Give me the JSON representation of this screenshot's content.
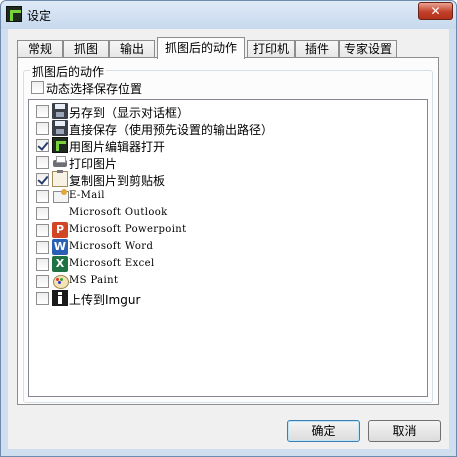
{
  "window": {
    "title": "设定",
    "close_label": "✕"
  },
  "tabs": [
    {
      "label": "常规"
    },
    {
      "label": "抓图"
    },
    {
      "label": "输出"
    },
    {
      "label": "抓图后的动作"
    },
    {
      "label": "打印机"
    },
    {
      "label": "插件"
    },
    {
      "label": "专家设置"
    }
  ],
  "active_tab": "抓图后的动作",
  "group": {
    "legend": "抓图后的动作",
    "dynamic_location_label": "动态选择保存位置",
    "dynamic_location_checked": false
  },
  "destinations": [
    {
      "label": "另存到（显示对话框）",
      "icon": "save-icon",
      "checked": false
    },
    {
      "label": "直接保存（使用预先设置的输出路径）",
      "icon": "save-icon",
      "checked": false
    },
    {
      "label": "用图片编辑器打开",
      "icon": "image-editor-icon",
      "checked": true
    },
    {
      "label": "打印图片",
      "icon": "printer-icon",
      "checked": false
    },
    {
      "label": "复制图片到剪贴板",
      "icon": "clipboard-icon",
      "checked": true
    },
    {
      "label": "E-Mail",
      "icon": "email-icon",
      "checked": false
    },
    {
      "label": "Microsoft Outlook",
      "icon": "",
      "checked": false
    },
    {
      "label": "Microsoft Powerpoint",
      "icon": "powerpoint-icon",
      "checked": false
    },
    {
      "label": "Microsoft Word",
      "icon": "word-icon",
      "checked": false
    },
    {
      "label": "Microsoft Excel",
      "icon": "excel-icon",
      "checked": false
    },
    {
      "label": "MS Paint",
      "icon": "paint-icon",
      "checked": false
    },
    {
      "label": "上传到Imgur",
      "icon": "imgur-icon",
      "checked": false
    }
  ],
  "icon_glyphs": {
    "powerpoint": "P",
    "word": "W",
    "excel": "X"
  },
  "buttons": {
    "ok": "确定",
    "cancel": "取消"
  }
}
